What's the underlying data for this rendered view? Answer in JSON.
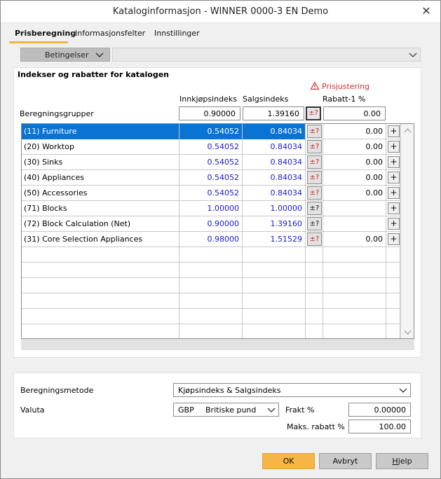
{
  "window": {
    "title": "Kataloginformasjon - WINNER 0000-3 EN Demo"
  },
  "tabs": [
    {
      "label": "Prisberegning"
    },
    {
      "label": "Informasjonsfelter"
    },
    {
      "label": "Innstillinger"
    }
  ],
  "conditions": {
    "button_label": "Betingelser",
    "dropdown_value": ""
  },
  "section": {
    "title": "Indekser og rabatter for katalogen",
    "warning": "Prisjustering",
    "headers": {
      "purchase": "Innkjøpsindeks",
      "sales": "Salgsindeks",
      "discount": "Rabatt-1 %"
    },
    "group_label": "Beregningsgrupper",
    "group_purchase": "0.90000",
    "group_sales": "1.39160",
    "group_adjust": "±?",
    "group_discount": "0.00"
  },
  "rows": [
    {
      "name": "(11) Furniture",
      "purchase": "0.54052",
      "sales": "0.84034",
      "adjust": "±?",
      "discount": "0.00",
      "plus": "+"
    },
    {
      "name": "(20) Worktop",
      "purchase": "0.54052",
      "sales": "0.84034",
      "adjust": "±?",
      "discount": "0.00",
      "plus": "+"
    },
    {
      "name": "(30) Sinks",
      "purchase": "0.54052",
      "sales": "0.84034",
      "adjust": "±?",
      "discount": "0.00",
      "plus": "+"
    },
    {
      "name": "(40) Appliances",
      "purchase": "0.54052",
      "sales": "0.84034",
      "adjust": "±?",
      "discount": "0.00",
      "plus": "+"
    },
    {
      "name": "(50) Accessories",
      "purchase": "0.54052",
      "sales": "0.84034",
      "adjust": "±?",
      "discount": "0.00",
      "plus": "+"
    },
    {
      "name": "(71) Blocks",
      "purchase": "1.00000",
      "sales": "1.00000",
      "adjust": "±?",
      "discount": "",
      "plus": "+"
    },
    {
      "name": "(72) Block Calculation (Net)",
      "purchase": "0.90000",
      "sales": "1.39160",
      "adjust": "±?",
      "discount": "",
      "plus": "+"
    },
    {
      "name": "(31) Core Selection Appliances",
      "purchase": "0.98000",
      "sales": "1.51529",
      "adjust": "±?",
      "discount": "0.00",
      "plus": "+"
    }
  ],
  "bottom": {
    "method_label": "Beregningsmetode",
    "method_value": "Kjøpsindeks & Salgsindeks",
    "currency_label": "Valuta",
    "currency_code": "GBP",
    "currency_name": "Britiske pund",
    "freight_label": "Frakt %",
    "freight_value": "0.00000",
    "maxdisc_label": "Maks. rabatt %",
    "maxdisc_value": "100.00"
  },
  "buttons": {
    "ok": "OK",
    "cancel": "Avbryt",
    "help_u": "H",
    "help_rest": "jelp"
  },
  "colors": {
    "accent": "#f5b646",
    "selection": "#0a74d4",
    "index_text": "#1a1acd",
    "warning": "#d03030"
  }
}
